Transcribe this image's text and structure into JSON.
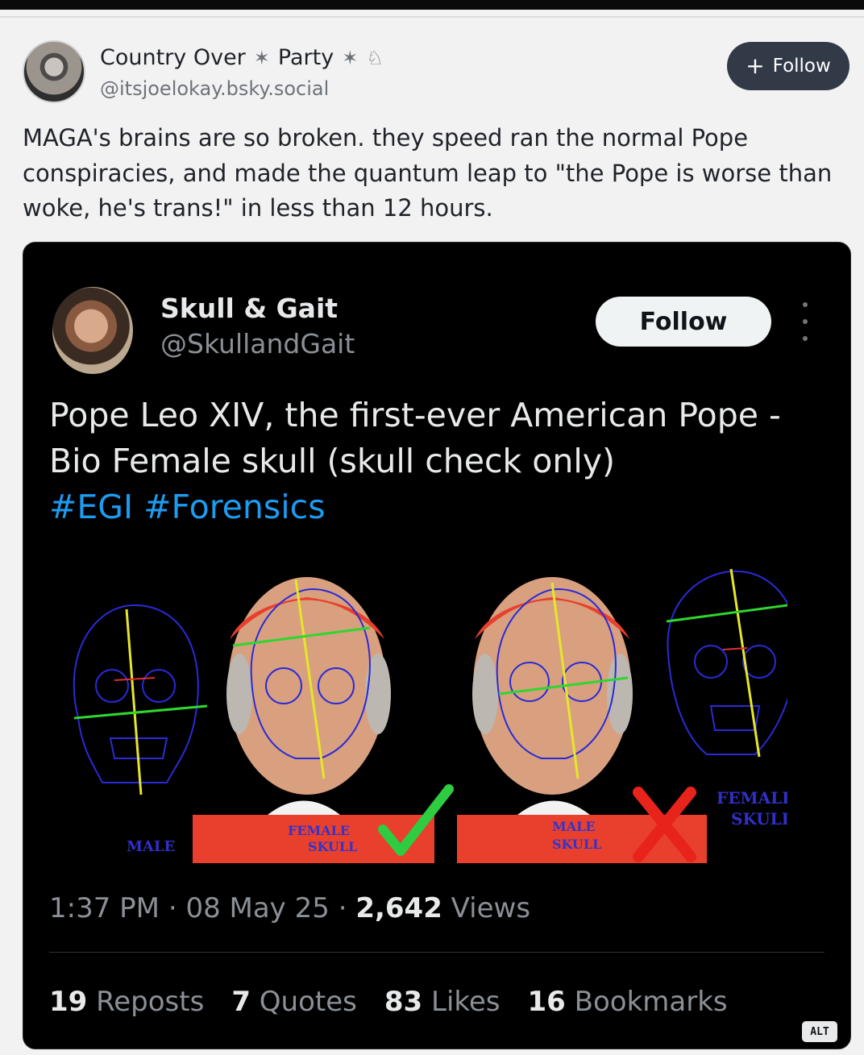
{
  "outer_post": {
    "author_name": "Country Over",
    "author_name_2": "Party",
    "handle": "@itsjoelokay.bsky.social",
    "follow_label": "Follow",
    "follow_plus": "+",
    "body": "MAGA's brains are so broken. they speed ran the normal Pope conspiracies, and made the quantum leap to \"the Pope is worse than woke, he's trans!\" in less than 12 hours."
  },
  "embedded_post": {
    "author_name": "Skull & Gait",
    "handle": "@SkullandGait",
    "follow_label": "Follow",
    "text": "Pope Leo XIV, the first-ever American Pope - Bio Female skull (skull check only)",
    "hashtag_1": "#EGI",
    "hashtag_2": "#Forensics",
    "image_labels": {
      "male": "MALE",
      "female_skull": "FEMALE SKULL",
      "female_skull_line1": "FEMALE",
      "female_skull_line2": "SKULL",
      "male_skull_line1": "MALE",
      "male_skull_line2": "SKULL"
    },
    "time": "1:37 PM",
    "date": "08 May 25",
    "views_count": "2,642",
    "views_label": "Views",
    "separator": "·",
    "stats": [
      {
        "count": "19",
        "label": "Reposts"
      },
      {
        "count": "7",
        "label": "Quotes"
      },
      {
        "count": "83",
        "label": "Likes"
      },
      {
        "count": "16",
        "label": "Bookmarks"
      }
    ],
    "alt_badge": "ALT"
  },
  "colors": {
    "page_bg": "#f2f2f3",
    "follow_outer_bg": "#323a47",
    "card_bg": "#000000",
    "hashtag": "#1d9bf0",
    "robe_red": "#e8402c",
    "check_green": "#2ecc40",
    "cross_red": "#e8231c"
  }
}
